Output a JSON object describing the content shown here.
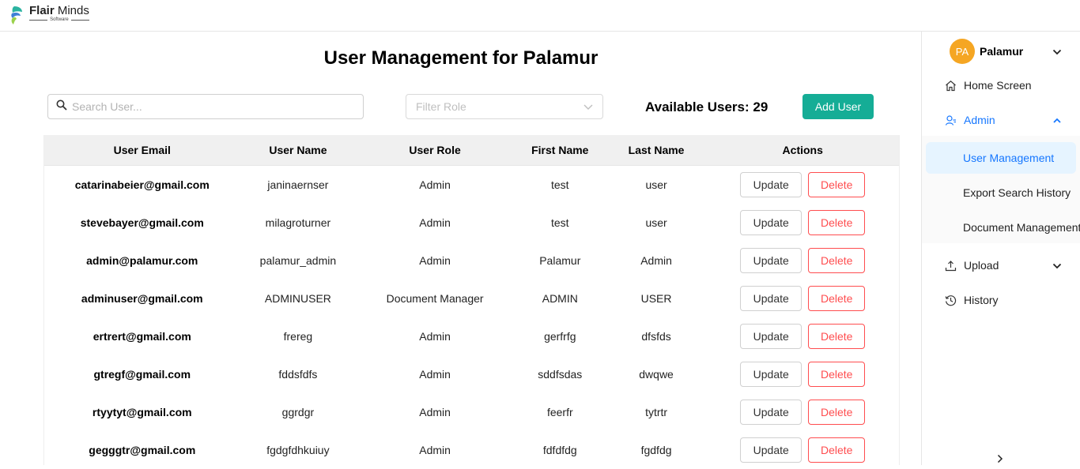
{
  "brand": {
    "name_bold": "Flair",
    "name_rest": " Minds",
    "tagline": "Software"
  },
  "page": {
    "title": "User Management for Palamur"
  },
  "toolbar": {
    "search_placeholder": "Search User...",
    "filter_placeholder": "Filter Role",
    "available_users": "Available Users: 29",
    "add_user_label": "Add User"
  },
  "table": {
    "headers": [
      "User Email",
      "User Name",
      "User Role",
      "First Name",
      "Last Name",
      "Actions"
    ],
    "update_label": "Update",
    "delete_label": "Delete",
    "rows": [
      {
        "email": "catarinabeier@gmail.com",
        "username": "janinaernser",
        "role": "Admin",
        "first": "test",
        "last": "user"
      },
      {
        "email": "stevebayer@gmail.com",
        "username": "milagroturner",
        "role": "Admin",
        "first": "test",
        "last": "user"
      },
      {
        "email": "admin@palamur.com",
        "username": "palamur_admin",
        "role": "Admin",
        "first": "Palamur",
        "last": "Admin"
      },
      {
        "email": "adminuser@gmail.com",
        "username": "ADMINUSER",
        "role": "Document Manager",
        "first": "ADMIN",
        "last": "USER"
      },
      {
        "email": "ertrert@gmail.com",
        "username": "frereg",
        "role": "Admin",
        "first": "gerfrfg",
        "last": "dfsfds"
      },
      {
        "email": "gtregf@gmail.com",
        "username": "fddsfdfs",
        "role": "Admin",
        "first": "sddfsdas",
        "last": "dwqwe"
      },
      {
        "email": "rtyytyt@gmail.com",
        "username": "ggrdgr",
        "role": "Admin",
        "first": "feerfr",
        "last": "tytrtr"
      },
      {
        "email": "gegggtr@gmail.com",
        "username": "fgdgfdhkuiuy",
        "role": "Admin",
        "first": "fdfdfdg",
        "last": "fgdfdg"
      }
    ]
  },
  "sidebar": {
    "avatar_initials": "PA",
    "user_name": "Palamur",
    "items": {
      "home": "Home Screen",
      "admin": "Admin",
      "user_management": "User Management",
      "export_history": "Export Search History",
      "document_management": "Document Management",
      "upload": "Upload",
      "history": "History"
    }
  },
  "colors": {
    "accent": "#15ad96",
    "danger": "#ff4d4f",
    "selected": "#1677ff",
    "avatar": "#f5a623"
  }
}
